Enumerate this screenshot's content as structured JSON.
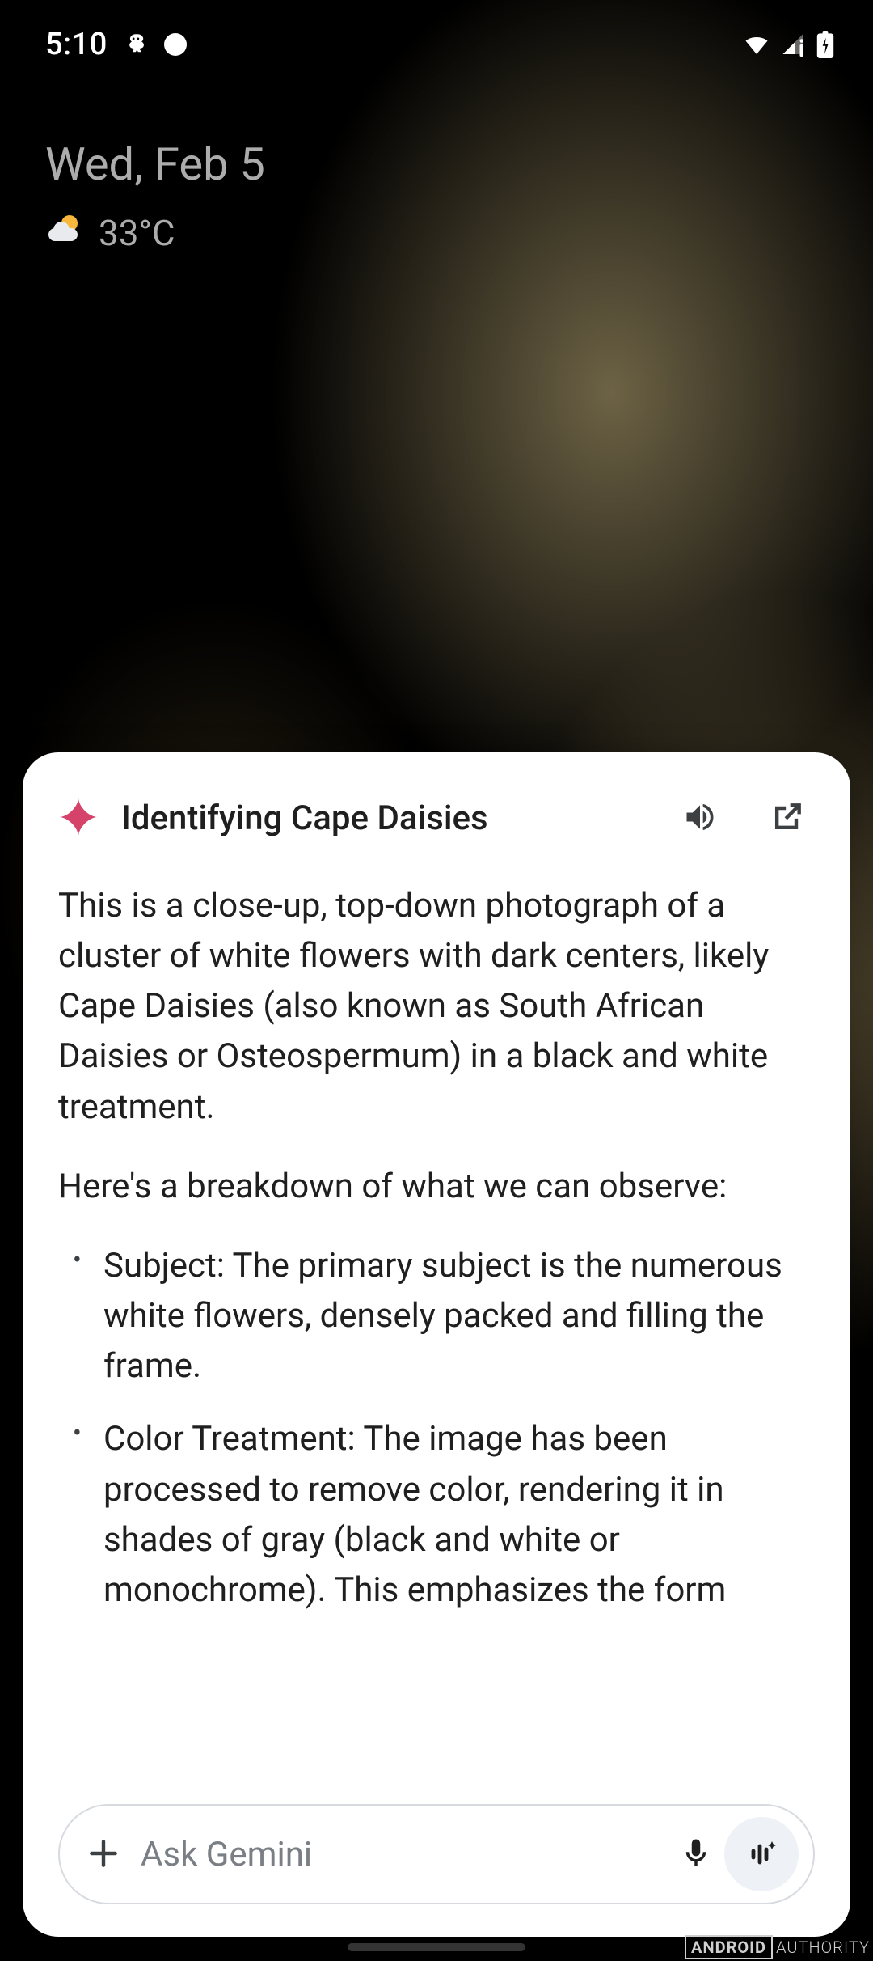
{
  "status": {
    "time": "5:10"
  },
  "home": {
    "date": "Wed, Feb 5",
    "temp": "33°C"
  },
  "card": {
    "title": "Identifying Cape Daisies",
    "p1": "This is a close-up, top-down photograph of a cluster of white flowers with dark centers, likely Cape Daisies (also known as South African Daisies or Osteospermum) in a black and white treatment.",
    "p2": "Here's a breakdown of what we can observe:",
    "b1": "Subject: The primary subject is the numerous white flowers, densely packed and filling the frame.",
    "b2": "Color Treatment: The image has been processed to remove color, rendering it in shades of gray (black and white or monochrome). This emphasizes the form"
  },
  "input": {
    "placeholder": "Ask Gemini"
  },
  "watermark": {
    "a": "ANDROID",
    "b": "AUTHORITY"
  }
}
